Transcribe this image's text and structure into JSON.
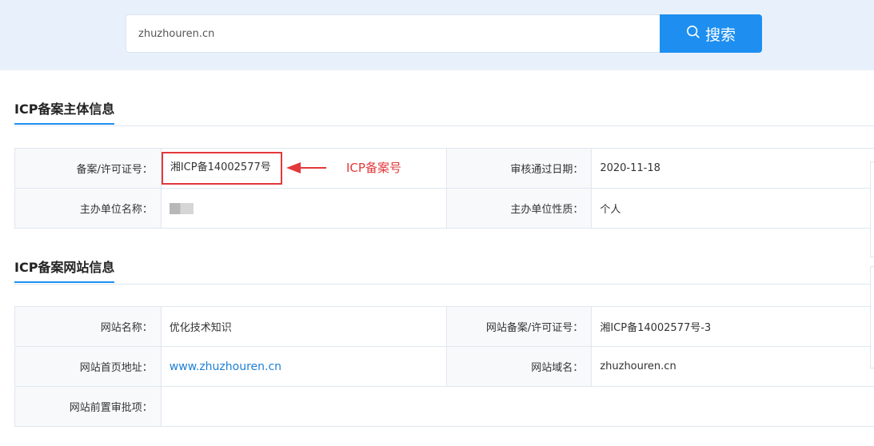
{
  "search": {
    "value": "zhuzhouren.cn",
    "button_label": "搜索"
  },
  "entity_section": {
    "title": "ICP备案主体信息",
    "rows": [
      {
        "label1": "备案/许可证号：",
        "value1": "湘ICP备14002577号",
        "label2": "审核通过日期：",
        "value2": "2020-11-18"
      },
      {
        "label1": "主办单位名称：",
        "value1": "",
        "label2": "主办单位性质：",
        "value2": "个人"
      }
    ]
  },
  "annotation": {
    "text": "ICP备案号",
    "color": "#e2393a"
  },
  "website_section": {
    "title": "ICP备案网站信息",
    "rows": [
      {
        "label1": "网站名称：",
        "value1": "优化技术知识",
        "label2": "网站备案/许可证号：",
        "value2": "湘ICP备14002577号-3"
      },
      {
        "label1": "网站首页地址：",
        "value1": "www.zhuzhouren.cn",
        "label2": "网站域名：",
        "value2": "zhuzhouren.cn"
      },
      {
        "label1": "网站前置审批项：",
        "value1": "",
        "label2": "",
        "value2": ""
      }
    ]
  },
  "colors": {
    "accent": "#1e8ff0",
    "header_bg": "#e8f1fb",
    "highlight": "#e2393a"
  }
}
